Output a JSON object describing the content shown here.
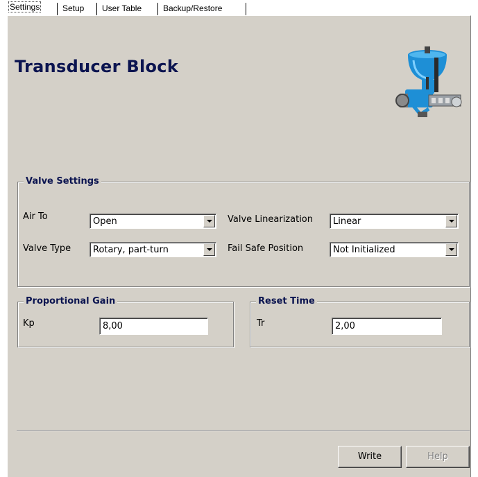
{
  "tabs": [
    {
      "label": "Settings",
      "active": true
    },
    {
      "label": "Setup"
    },
    {
      "label": "User Table"
    },
    {
      "label": "Backup/Restore"
    }
  ],
  "title": "Transducer Block",
  "valve_settings": {
    "legend": "Valve Settings",
    "air_to": {
      "label": "Air To",
      "value": "Open"
    },
    "valve_type": {
      "label": "Valve Type",
      "value": "Rotary, part-turn"
    },
    "valve_linearization": {
      "label": "Valve Linearization",
      "value": "Linear"
    },
    "fail_safe_position": {
      "label": "Fail Safe Position",
      "value": "Not Initialized"
    }
  },
  "proportional_gain": {
    "legend": "Proportional Gain",
    "label": "Kp",
    "value": "8,00"
  },
  "reset_time": {
    "legend": "Reset Time",
    "label": "Tr",
    "value": "2,00"
  },
  "buttons": {
    "write": "Write",
    "help": "Help"
  },
  "colors": {
    "panel": "#d4d0c8",
    "title": "#0b1450",
    "valve_blue": "#1e8fd6"
  }
}
